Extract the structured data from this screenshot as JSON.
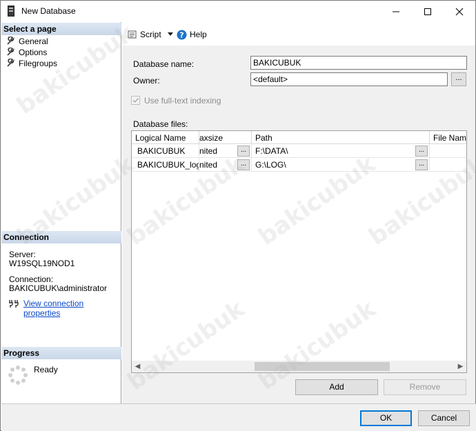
{
  "window": {
    "title": "New Database"
  },
  "left": {
    "select_page_header": "Select a page",
    "pages": [
      "General",
      "Options",
      "Filegroups"
    ],
    "connection_header": "Connection",
    "server_label": "Server:",
    "server_value": "W19SQL19NOD1",
    "connection_label": "Connection:",
    "connection_value": "BAKICUBUK\\administrator",
    "view_connection_link": "View connection properties",
    "progress_header": "Progress",
    "progress_status": "Ready"
  },
  "toolbar": {
    "script_label": "Script",
    "help_label": "Help"
  },
  "general": {
    "db_name_label": "Database name:",
    "db_name_value": "BAKICUBUK",
    "owner_label": "Owner:",
    "owner_value": "<default>",
    "fulltext_label": "Use full-text indexing",
    "db_files_label": "Database files:"
  },
  "grid": {
    "columns": [
      "Logical Name",
      "axsize",
      "Path",
      "File Name"
    ],
    "rows": [
      {
        "logical_name": "BAKICUBUK",
        "maxsize": "nited",
        "path": "F:\\DATA\\"
      },
      {
        "logical_name": "BAKICUBUK_log",
        "maxsize": "nited",
        "path": "G:\\LOG\\"
      }
    ],
    "ellipsis": "..."
  },
  "buttons": {
    "add": "Add",
    "remove": "Remove",
    "ok": "OK",
    "cancel": "Cancel",
    "owner_browse": "..."
  },
  "watermark_text": "bakicubuk",
  "colors": {
    "link": "#0a47c9",
    "section_header": "#d3dfee",
    "default_button_border": "#0078d7"
  }
}
